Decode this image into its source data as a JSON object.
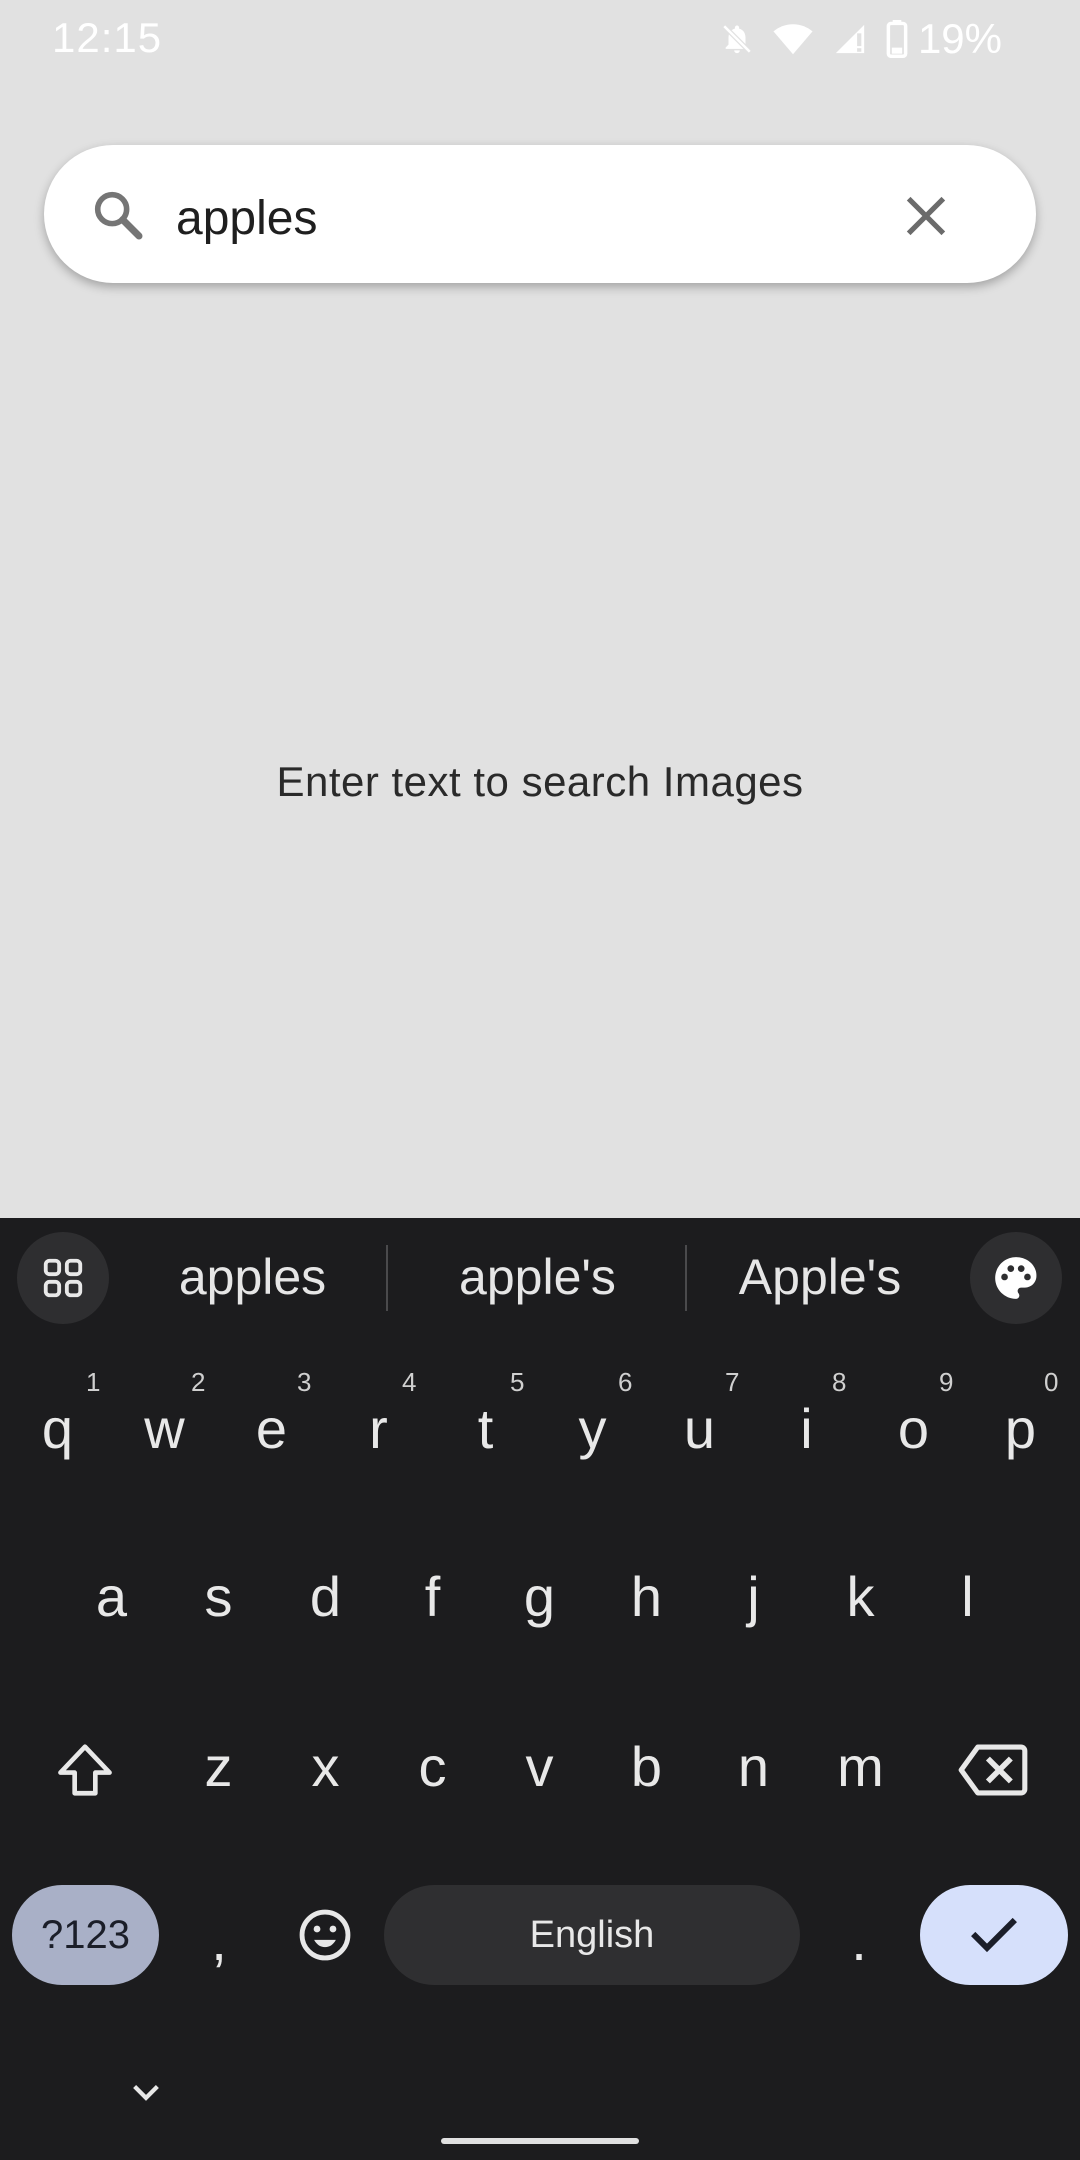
{
  "status_bar": {
    "time": "12:15",
    "battery": "19%",
    "icons": [
      "mute-bell-icon",
      "wifi-icon",
      "signal-icon",
      "battery-icon"
    ]
  },
  "search": {
    "value": "apples",
    "placeholder": ""
  },
  "main": {
    "message": "Enter text to search Images"
  },
  "keyboard": {
    "suggestions": [
      "apples",
      "apple's",
      "Apple's"
    ],
    "row1": [
      {
        "key": "q",
        "hint": "1"
      },
      {
        "key": "w",
        "hint": "2"
      },
      {
        "key": "e",
        "hint": "3"
      },
      {
        "key": "r",
        "hint": "4"
      },
      {
        "key": "t",
        "hint": "5"
      },
      {
        "key": "y",
        "hint": "6"
      },
      {
        "key": "u",
        "hint": "7"
      },
      {
        "key": "i",
        "hint": "8"
      },
      {
        "key": "o",
        "hint": "9"
      },
      {
        "key": "p",
        "hint": "0"
      }
    ],
    "row2": [
      "a",
      "s",
      "d",
      "f",
      "g",
      "h",
      "j",
      "k",
      "l"
    ],
    "row3": [
      "z",
      "x",
      "c",
      "v",
      "b",
      "n",
      "m"
    ],
    "symbols_label": "?123",
    "comma": ",",
    "space_label": "English",
    "period": ".",
    "colors": {
      "background": "#1c1c1e",
      "symbols_key": "#a9b0c7",
      "enter_key": "#d6e0fb"
    }
  }
}
